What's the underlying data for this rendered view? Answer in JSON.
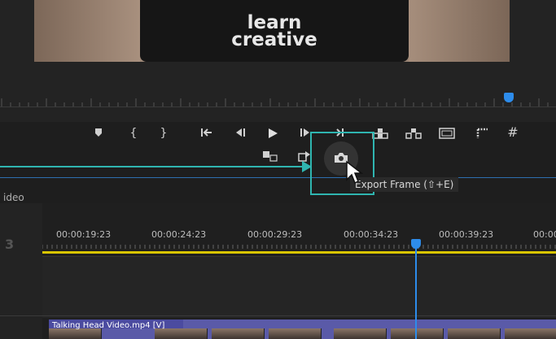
{
  "monitor": {
    "shirt_text": "learn\ncreative"
  },
  "transport": {
    "buttons": [
      {
        "name": "add-marker-icon",
        "label": "marker"
      },
      {
        "name": "mark-in-icon",
        "label": "{"
      },
      {
        "name": "mark-out-icon",
        "label": "}"
      },
      {
        "name": "go-to-in-icon",
        "label": "go to in"
      },
      {
        "name": "step-back-icon",
        "label": "step back"
      },
      {
        "name": "play-icon",
        "label": "play"
      },
      {
        "name": "step-forward-icon",
        "label": "step forward"
      },
      {
        "name": "go-to-out-icon",
        "label": "go to out"
      },
      {
        "name": "lift-icon",
        "label": "lift"
      },
      {
        "name": "extract-icon",
        "label": "extract"
      },
      {
        "name": "safe-margins-icon",
        "label": "safe margins"
      },
      {
        "name": "overlays-icon",
        "label": "overlays"
      },
      {
        "name": "grid-icon",
        "label": "#"
      }
    ],
    "mark_in_label": "{",
    "mark_out_label": "}",
    "grid_label": "#"
  },
  "tooltip": {
    "text": "Export Frame (⇧+E)"
  },
  "timeline": {
    "panel_label": "ideo",
    "track_number": "3",
    "timecodes": [
      "00:00:19:23",
      "00:00:24:23",
      "00:00:29:23",
      "00:00:34:23",
      "00:00:39:23",
      "00:00"
    ],
    "clip_label": "Talking Head Video.mp4 [V]"
  },
  "colors": {
    "accent": "#2fb5b0",
    "playhead": "#2d8ceb",
    "work_area": "#d9c500",
    "clip": "#5a5aa8"
  }
}
